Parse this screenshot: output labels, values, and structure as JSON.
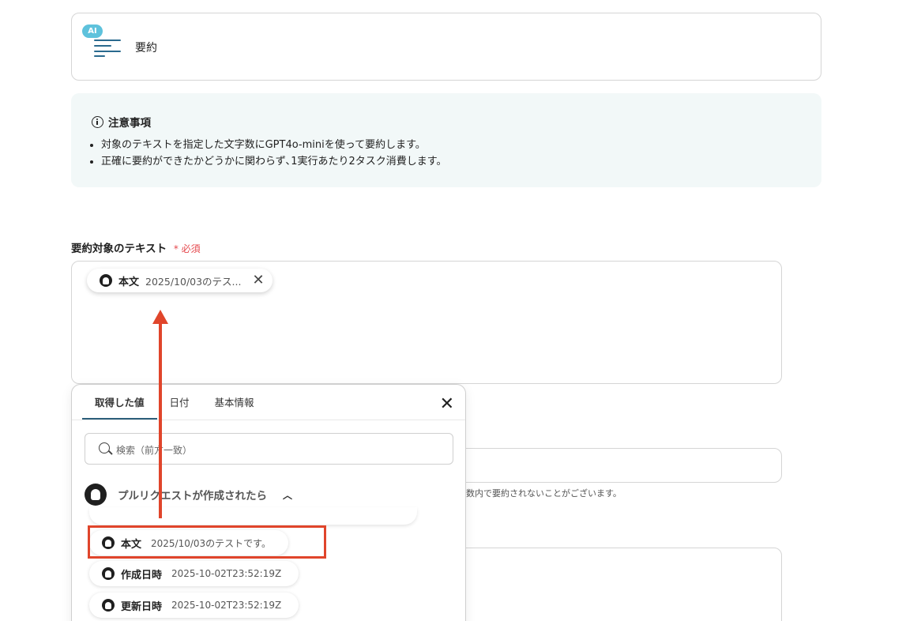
{
  "action": {
    "badge": "AI",
    "title": "要約"
  },
  "notice": {
    "heading": "注意事項",
    "items": [
      "対象のテキストを指定した文字数にGPT4o-miniを使って要約します。",
      "正確に要約ができたかどうかに関わらず､1実行あたり2タスク消費します。"
    ]
  },
  "field": {
    "label": "要約対象のテキスト",
    "required_mark": "*",
    "required_text": "必須",
    "chip": {
      "key": "本文",
      "value": "2025/10/03のテス..."
    }
  },
  "helper_text": "数内で要約されないことがございます。",
  "picker": {
    "tabs": [
      "取得した値",
      "日付",
      "基本情報"
    ],
    "search_placeholder": "検索（前方一致）",
    "section_title": "プルリクエストが作成されたら",
    "items": [
      {
        "key": "本文",
        "value": "2025/10/03のテストです。"
      },
      {
        "key": "作成日時",
        "value": "2025-10-02T23:52:19Z"
      },
      {
        "key": "更新日時",
        "value": "2025-10-02T23:52:19Z"
      }
    ]
  },
  "icons": {
    "close": "close-icon",
    "search": "search-icon",
    "chevron": "chevron-up-icon",
    "source": "github-icon",
    "info": "info-icon"
  },
  "colors": {
    "accent": "#2c5f7a",
    "highlight": "#e0452b",
    "required": "#e5484d",
    "notice_bg": "#f2f8f8",
    "ai_badge": "#5ec2dc"
  }
}
